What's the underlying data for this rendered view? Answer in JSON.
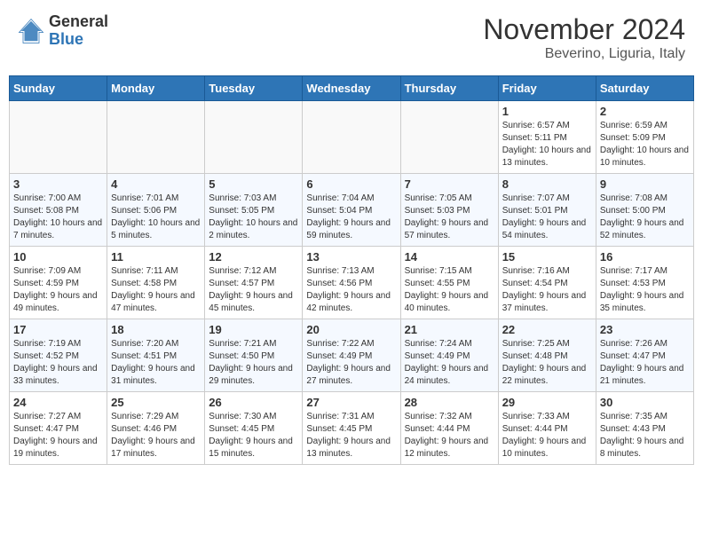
{
  "logo": {
    "general": "General",
    "blue": "Blue"
  },
  "header": {
    "month": "November 2024",
    "location": "Beverino, Liguria, Italy"
  },
  "days_of_week": [
    "Sunday",
    "Monday",
    "Tuesday",
    "Wednesday",
    "Thursday",
    "Friday",
    "Saturday"
  ],
  "weeks": [
    [
      {
        "day": "",
        "info": ""
      },
      {
        "day": "",
        "info": ""
      },
      {
        "day": "",
        "info": ""
      },
      {
        "day": "",
        "info": ""
      },
      {
        "day": "",
        "info": ""
      },
      {
        "day": "1",
        "info": "Sunrise: 6:57 AM\nSunset: 5:11 PM\nDaylight: 10 hours and 13 minutes."
      },
      {
        "day": "2",
        "info": "Sunrise: 6:59 AM\nSunset: 5:09 PM\nDaylight: 10 hours and 10 minutes."
      }
    ],
    [
      {
        "day": "3",
        "info": "Sunrise: 7:00 AM\nSunset: 5:08 PM\nDaylight: 10 hours and 7 minutes."
      },
      {
        "day": "4",
        "info": "Sunrise: 7:01 AM\nSunset: 5:06 PM\nDaylight: 10 hours and 5 minutes."
      },
      {
        "day": "5",
        "info": "Sunrise: 7:03 AM\nSunset: 5:05 PM\nDaylight: 10 hours and 2 minutes."
      },
      {
        "day": "6",
        "info": "Sunrise: 7:04 AM\nSunset: 5:04 PM\nDaylight: 9 hours and 59 minutes."
      },
      {
        "day": "7",
        "info": "Sunrise: 7:05 AM\nSunset: 5:03 PM\nDaylight: 9 hours and 57 minutes."
      },
      {
        "day": "8",
        "info": "Sunrise: 7:07 AM\nSunset: 5:01 PM\nDaylight: 9 hours and 54 minutes."
      },
      {
        "day": "9",
        "info": "Sunrise: 7:08 AM\nSunset: 5:00 PM\nDaylight: 9 hours and 52 minutes."
      }
    ],
    [
      {
        "day": "10",
        "info": "Sunrise: 7:09 AM\nSunset: 4:59 PM\nDaylight: 9 hours and 49 minutes."
      },
      {
        "day": "11",
        "info": "Sunrise: 7:11 AM\nSunset: 4:58 PM\nDaylight: 9 hours and 47 minutes."
      },
      {
        "day": "12",
        "info": "Sunrise: 7:12 AM\nSunset: 4:57 PM\nDaylight: 9 hours and 45 minutes."
      },
      {
        "day": "13",
        "info": "Sunrise: 7:13 AM\nSunset: 4:56 PM\nDaylight: 9 hours and 42 minutes."
      },
      {
        "day": "14",
        "info": "Sunrise: 7:15 AM\nSunset: 4:55 PM\nDaylight: 9 hours and 40 minutes."
      },
      {
        "day": "15",
        "info": "Sunrise: 7:16 AM\nSunset: 4:54 PM\nDaylight: 9 hours and 37 minutes."
      },
      {
        "day": "16",
        "info": "Sunrise: 7:17 AM\nSunset: 4:53 PM\nDaylight: 9 hours and 35 minutes."
      }
    ],
    [
      {
        "day": "17",
        "info": "Sunrise: 7:19 AM\nSunset: 4:52 PM\nDaylight: 9 hours and 33 minutes."
      },
      {
        "day": "18",
        "info": "Sunrise: 7:20 AM\nSunset: 4:51 PM\nDaylight: 9 hours and 31 minutes."
      },
      {
        "day": "19",
        "info": "Sunrise: 7:21 AM\nSunset: 4:50 PM\nDaylight: 9 hours and 29 minutes."
      },
      {
        "day": "20",
        "info": "Sunrise: 7:22 AM\nSunset: 4:49 PM\nDaylight: 9 hours and 27 minutes."
      },
      {
        "day": "21",
        "info": "Sunrise: 7:24 AM\nSunset: 4:49 PM\nDaylight: 9 hours and 24 minutes."
      },
      {
        "day": "22",
        "info": "Sunrise: 7:25 AM\nSunset: 4:48 PM\nDaylight: 9 hours and 22 minutes."
      },
      {
        "day": "23",
        "info": "Sunrise: 7:26 AM\nSunset: 4:47 PM\nDaylight: 9 hours and 21 minutes."
      }
    ],
    [
      {
        "day": "24",
        "info": "Sunrise: 7:27 AM\nSunset: 4:47 PM\nDaylight: 9 hours and 19 minutes."
      },
      {
        "day": "25",
        "info": "Sunrise: 7:29 AM\nSunset: 4:46 PM\nDaylight: 9 hours and 17 minutes."
      },
      {
        "day": "26",
        "info": "Sunrise: 7:30 AM\nSunset: 4:45 PM\nDaylight: 9 hours and 15 minutes."
      },
      {
        "day": "27",
        "info": "Sunrise: 7:31 AM\nSunset: 4:45 PM\nDaylight: 9 hours and 13 minutes."
      },
      {
        "day": "28",
        "info": "Sunrise: 7:32 AM\nSunset: 4:44 PM\nDaylight: 9 hours and 12 minutes."
      },
      {
        "day": "29",
        "info": "Sunrise: 7:33 AM\nSunset: 4:44 PM\nDaylight: 9 hours and 10 minutes."
      },
      {
        "day": "30",
        "info": "Sunrise: 7:35 AM\nSunset: 4:43 PM\nDaylight: 9 hours and 8 minutes."
      }
    ]
  ]
}
